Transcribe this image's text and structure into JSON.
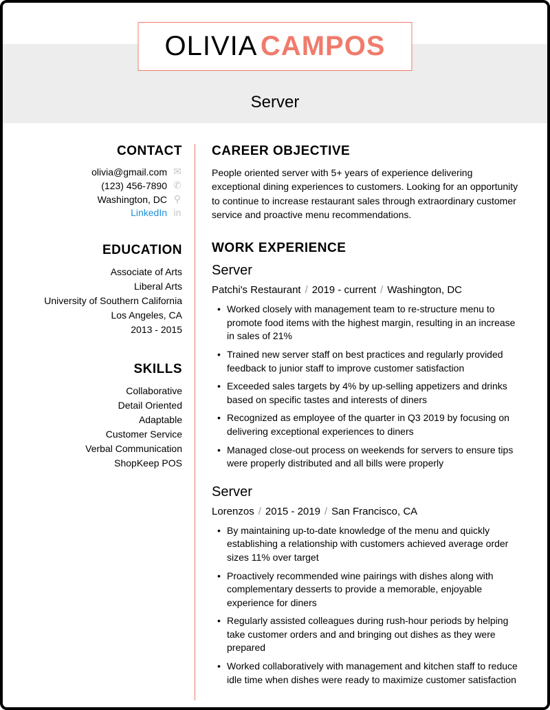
{
  "name": {
    "first": "OLIVIA",
    "last": "CAMPOS"
  },
  "title": "Server",
  "contact": {
    "heading": "CONTACT",
    "email": "olivia@gmail.com",
    "phone": "(123) 456-7890",
    "location": "Washington, DC",
    "linkedin": "LinkedIn"
  },
  "education": {
    "heading": "EDUCATION",
    "lines": [
      "Associate of Arts",
      "Liberal Arts",
      "University of Southern California",
      "Los Angeles, CA",
      "2013 - 2015"
    ]
  },
  "skills": {
    "heading": "SKILLS",
    "items": [
      "Collaborative",
      "Detail Oriented",
      "Adaptable",
      "Customer Service",
      "Verbal Communication",
      "ShopKeep POS"
    ]
  },
  "objective": {
    "heading": "CAREER OBJECTIVE",
    "text": "People oriented server with 5+ years of experience delivering exceptional dining experiences to customers. Looking for an opportunity to continue to increase restaurant sales through extraordinary customer service and proactive menu recommendations."
  },
  "experience": {
    "heading": "WORK EXPERIENCE",
    "jobs": [
      {
        "role": "Server",
        "company": "Patchi's Restaurant",
        "dates": "2019 - current",
        "location": "Washington, DC",
        "bullets": [
          "Worked closely with management team to re-structure menu to promote food items with the highest margin, resulting in an increase in sales of 21%",
          "Trained new server staff on best practices and regularly provided feedback to junior staff to improve customer satisfaction",
          "Exceeded sales targets by 4% by up-selling appetizers and drinks based on specific tastes and interests of diners",
          "Recognized as employee of the quarter in Q3 2019 by focusing on delivering exceptional experiences to diners",
          "Managed close-out process on weekends for servers to ensure tips were properly distributed and all bills were properly"
        ]
      },
      {
        "role": "Server",
        "company": "Lorenzos",
        "dates": "2015 - 2019",
        "location": "San Francisco, CA",
        "bullets": [
          "By maintaining up-to-date knowledge of the menu and quickly establishing a relationship with customers achieved average order sizes 11% over target",
          "Proactively recommended wine pairings with dishes along with complementary desserts to provide a memorable, enjoyable experience for diners",
          "Regularly assisted colleagues during rush-hour periods by helping take customer orders and and bringing out dishes as they were prepared",
          "Worked collaboratively with management and kitchen staff to reduce idle time when dishes were ready to maximize customer satisfaction"
        ]
      }
    ]
  }
}
